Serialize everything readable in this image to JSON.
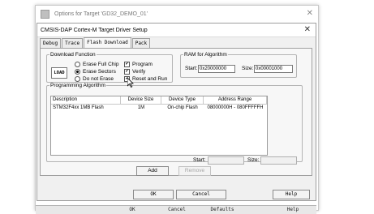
{
  "outer_window": {
    "title": "Options for Target 'GD32_DEMO_01'",
    "close": "✕"
  },
  "outer_buttons": [
    "OK",
    "Cancel",
    "Defaults",
    "Help"
  ],
  "dialog": {
    "title": "CMSIS-DAP Cortex-M Target Driver Setup",
    "close": "✕",
    "tabs": [
      "Debug",
      "Trace",
      "Flash Download",
      "Pack"
    ],
    "active_tab": "Flash Download",
    "download_function": {
      "legend": "Download Function",
      "load_icon": "LOAD",
      "radios": [
        {
          "label": "Erase Full Chip",
          "selected": false
        },
        {
          "label": "Erase Sectors",
          "selected": true
        },
        {
          "label": "Do not Erase",
          "selected": false
        }
      ],
      "checks": [
        {
          "label": "Program",
          "checked": true
        },
        {
          "label": "Verify",
          "checked": true
        },
        {
          "label": "Reset and Run",
          "checked": true
        }
      ]
    },
    "ram": {
      "legend": "RAM for Algorithm",
      "start_label": "Start:",
      "start_value": "0x20000000",
      "size_label": "Size:",
      "size_value": "0x00001000"
    },
    "programming": {
      "legend": "Programming Algorithm",
      "columns": [
        "Description",
        "Device Size",
        "Device Type",
        "Address Range"
      ],
      "rows": [
        [
          "STM32F4xx 1MB Flash",
          "1M",
          "On-chip Flash",
          "08000000H - 080FFFFFH"
        ]
      ],
      "start_label": "Start:",
      "size_label": "Size:",
      "start_value": "",
      "size_value": ""
    },
    "add_label": "Add",
    "remove_label": "Remove",
    "ok_label": "OK",
    "cancel_label": "Cancel",
    "help_label": "Help"
  }
}
